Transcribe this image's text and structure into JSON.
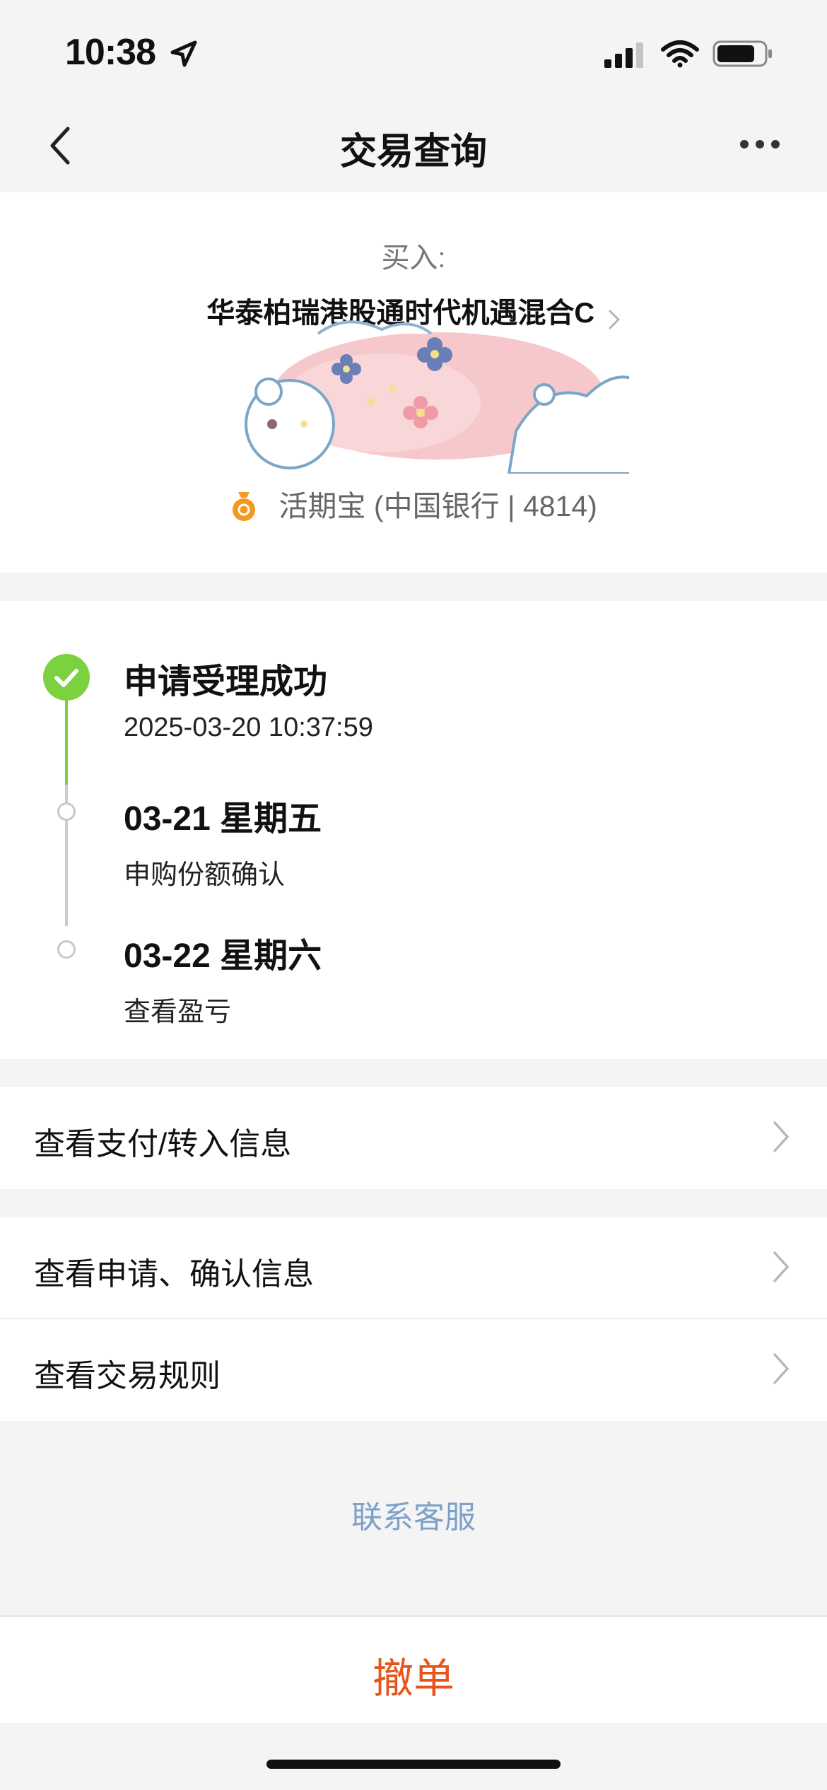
{
  "status_bar": {
    "time": "10:38",
    "icons": [
      "location-arrow-icon",
      "cellular-signal-icon",
      "wifi-icon",
      "battery-icon"
    ]
  },
  "nav": {
    "title": "交易查询",
    "back_icon": "chevron-left-icon",
    "more_icon": "more-dots-icon"
  },
  "header": {
    "buy_label": "买入:",
    "fund_name": "华泰柏瑞港股通时代机遇混合C",
    "pay_method": "活期宝 (中国银行 | 4814)",
    "pay_icon": "money-bag-icon"
  },
  "timeline": {
    "steps": [
      {
        "title": "申请受理成功",
        "sub": "2025-03-20 10:37:59",
        "status": "done"
      },
      {
        "title": "03-21 星期五",
        "sub": "申购份额确认",
        "status": "pending"
      },
      {
        "title": "03-22 星期六",
        "sub": "查看盈亏",
        "status": "pending"
      }
    ]
  },
  "rows": [
    {
      "label": "查看支付/转入信息"
    },
    {
      "label": "查看申请、确认信息"
    },
    {
      "label": "查看交易规则"
    }
  ],
  "contact_label": "联系客服",
  "cancel_label": "撤单",
  "colors": {
    "accent_orange": "#e8551c",
    "success_green": "#7bd23e",
    "link_blue": "#7ea1c9",
    "background": "#f4f4f4"
  }
}
